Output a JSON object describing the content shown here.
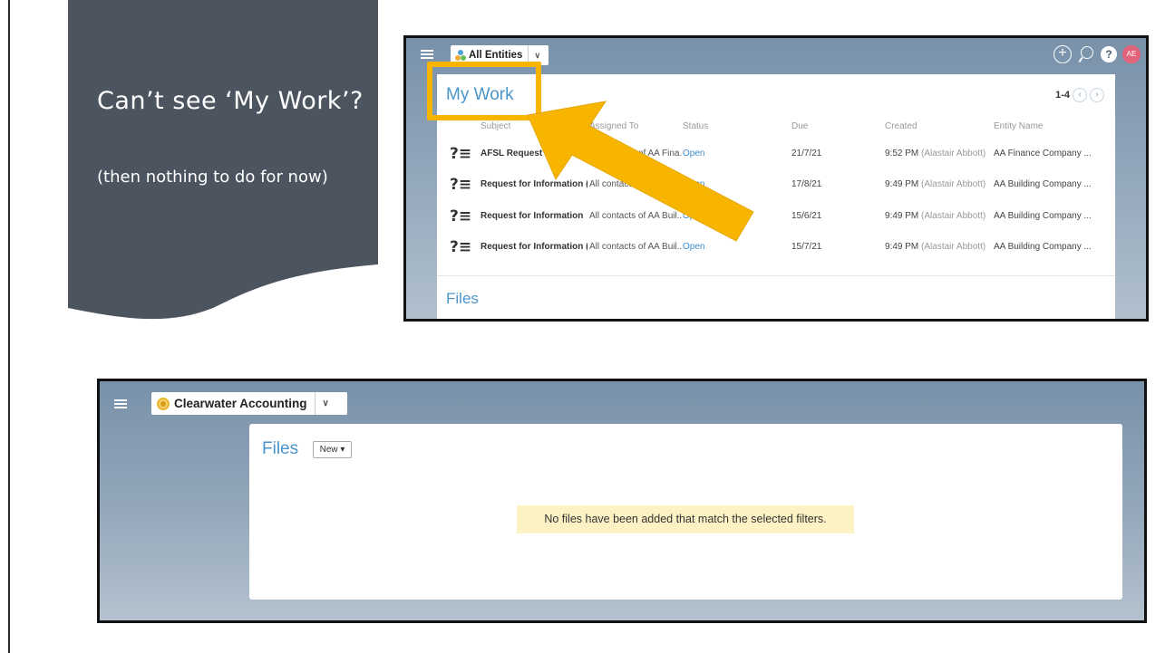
{
  "banner": {
    "title": "Can’t see ‘My Work’?",
    "subtitle": "(then nothing to do for now)",
    "color": "#4b545f"
  },
  "screenshot_top": {
    "entity_selector": "All Entities",
    "avatar_initials": "AE",
    "help_label": "?",
    "add_label": "+",
    "section_title": "My Work",
    "pager": "1-4",
    "columns": [
      "Subject",
      "Assigned To",
      "Status",
      "Due",
      "Created",
      "Entity Name"
    ],
    "rows": [
      {
        "subject": "AFSL Request for Information",
        "assigned": "All contacts of AA Fina...",
        "status": "Open",
        "due": "21/7/21",
        "created": "9:52 PM",
        "created_by": "(Alastair Abbott)",
        "entity": "AA Finance Company ..."
      },
      {
        "subject": "Request for Information (...",
        "assigned": "All contacts of AA Buil...",
        "status": "Open",
        "due": "17/8/21",
        "created": "9:49 PM",
        "created_by": "(Alastair Abbott)",
        "entity": "AA Building Company ..."
      },
      {
        "subject": "Request for Information",
        "assigned": "All contacts of AA Buil...",
        "status": "Open",
        "due": "15/6/21",
        "created": "9:49 PM",
        "created_by": "(Alastair Abbott)",
        "entity": "AA Building Company ..."
      },
      {
        "subject": "Request for Information (...",
        "assigned": "All contacts of AA Buil...",
        "status": "Open",
        "due": "15/7/21",
        "created": "9:49 PM",
        "created_by": "(Alastair Abbott)",
        "entity": "AA Building Company ..."
      }
    ],
    "files_title": "Files",
    "highlight_color": "#f7b500"
  },
  "screenshot_bottom": {
    "org_selector": "Clearwater Accounting",
    "files_title": "Files",
    "new_button": "New ▾",
    "empty_message": "No files have been added that match the selected filters."
  }
}
